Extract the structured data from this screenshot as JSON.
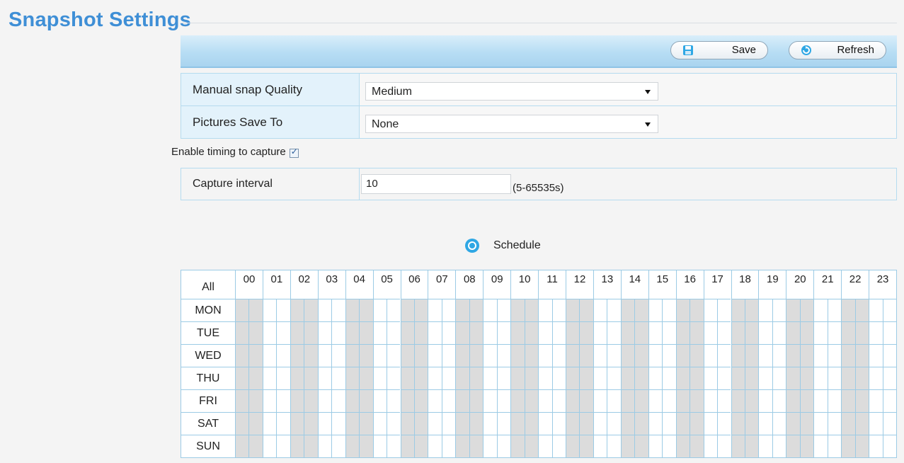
{
  "title": "Snapshot Settings",
  "toolbar": {
    "save_label": "Save",
    "refresh_label": "Refresh"
  },
  "settings": {
    "manual_quality_label": "Manual snap Quality",
    "manual_quality_value": "Medium",
    "save_to_label": "Pictures Save To",
    "save_to_value": "None"
  },
  "timing": {
    "label": "Enable timing to capture",
    "enabled": true
  },
  "interval": {
    "label": "Capture interval",
    "value": "10",
    "hint": "(5-65535s)"
  },
  "schedule": {
    "title": "Schedule",
    "all_label": "All",
    "hours": [
      "00",
      "01",
      "02",
      "03",
      "04",
      "05",
      "06",
      "07",
      "08",
      "09",
      "10",
      "11",
      "12",
      "13",
      "14",
      "15",
      "16",
      "17",
      "18",
      "19",
      "20",
      "21",
      "22",
      "23"
    ],
    "days": [
      "MON",
      "TUE",
      "WED",
      "THU",
      "FRI",
      "SAT",
      "SUN"
    ]
  },
  "colors": {
    "accent": "#3f8fd6",
    "grid_line": "#9ccbe5",
    "shaded_cell": "#dcdcdc"
  }
}
